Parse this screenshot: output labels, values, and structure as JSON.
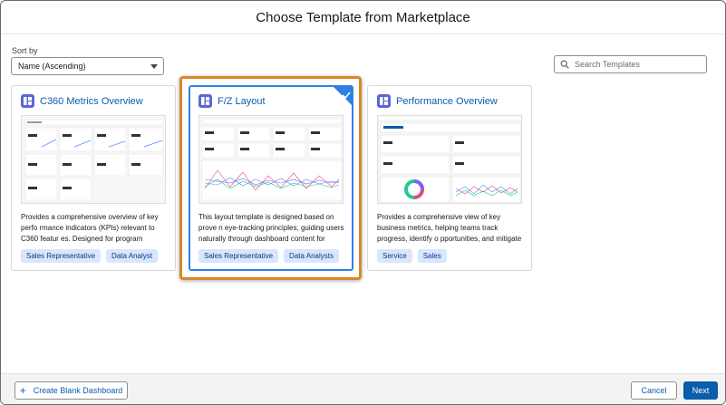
{
  "modal": {
    "title": "Choose Template from Marketplace"
  },
  "sort": {
    "label": "Sort by",
    "selected": "Name (Ascending)"
  },
  "search": {
    "placeholder": "Search Templates"
  },
  "cards": [
    {
      "title": "C360 Metrics Overview",
      "description": "Provides a comprehensive overview of key perfo rmance indicators (KPIs) relevant to C360 featur es. Designed for program managers and stak...",
      "tags": [
        "Sales Representative",
        "Data Analyst"
      ],
      "selected": false
    },
    {
      "title": "F/Z Layout",
      "description": "This layout template is designed based on prove n eye-tracking principles, guiding users naturally through dashboard content for maximized co...",
      "tags": [
        "Sales Representative",
        "Data Analysts"
      ],
      "selected": true
    },
    {
      "title": "Performance Overview",
      "description": "Provides a comprehensive view of key business metrics, helping teams track progress, identify o pportunities, and mitigate risks. Designed for s...",
      "tags": [
        "Service",
        "Sales"
      ],
      "selected": false
    }
  ],
  "footer": {
    "create_blank": "Create Blank Dashboard",
    "cancel": "Cancel",
    "next": "Next"
  },
  "colors": {
    "accent": "#0b5cab",
    "selected_border": "#2f80e4",
    "highlight": "#d9862a",
    "tag_bg": "#d8e6fe",
    "icon_bg": "#5a67d8"
  }
}
